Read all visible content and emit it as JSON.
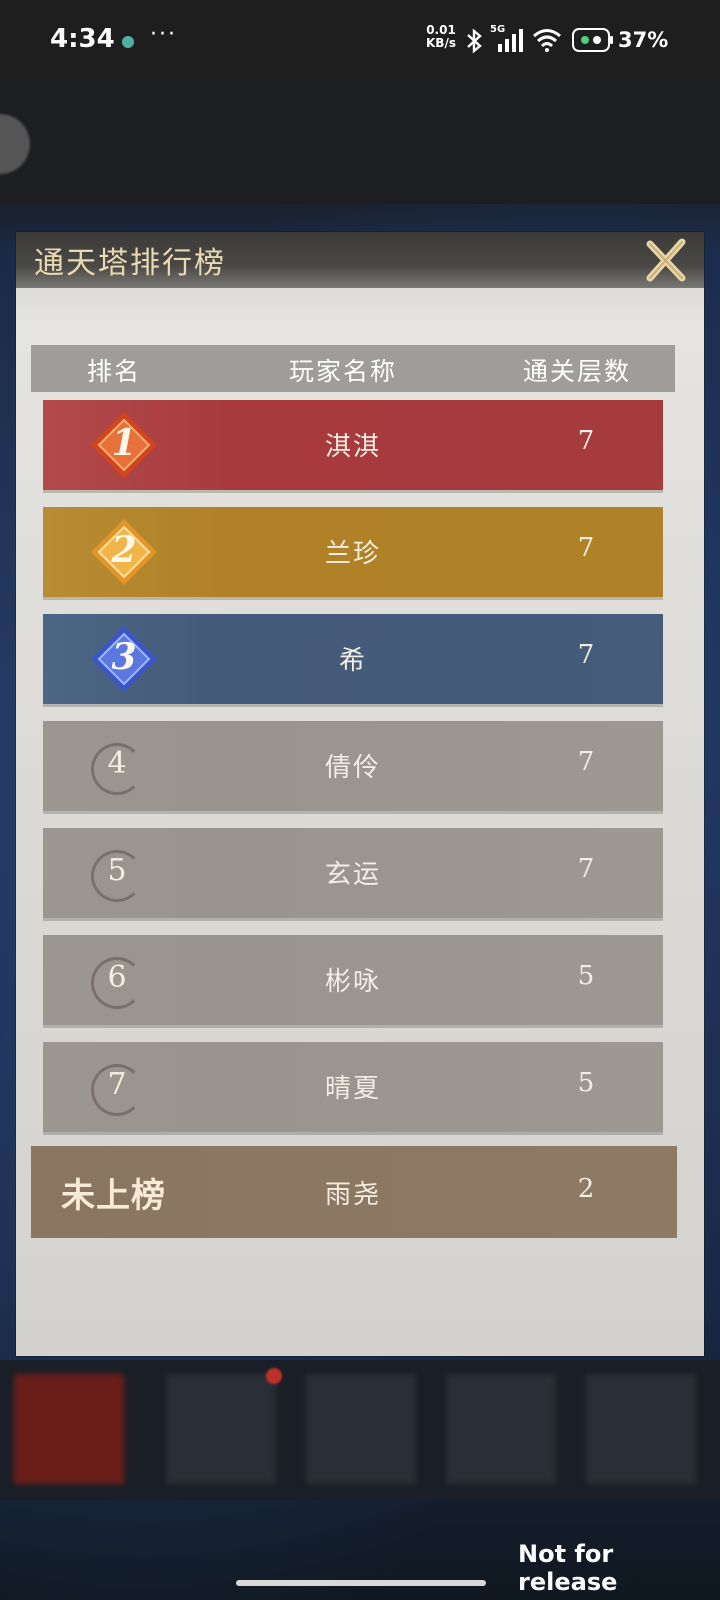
{
  "status_bar": {
    "time": "4:34",
    "more": "···",
    "net_speed_value": "0.01",
    "net_speed_unit": "KB/s",
    "network_type": "5G",
    "battery": "37%"
  },
  "dialog": {
    "title": "通天塔排行榜",
    "columns": {
      "rank": "排名",
      "player": "玩家名称",
      "floors": "通关层数"
    },
    "rows": [
      {
        "rank": "1",
        "name": "淇淇",
        "floors": "7",
        "tier_color": "#a83a3e"
      },
      {
        "rank": "2",
        "name": "兰珍",
        "floors": "7",
        "tier_color": "#b08126"
      },
      {
        "rank": "3",
        "name": "希",
        "floors": "7",
        "tier_color": "#435a78"
      },
      {
        "rank": "4",
        "name": "倩伶",
        "floors": "7"
      },
      {
        "rank": "5",
        "name": "玄运",
        "floors": "7"
      },
      {
        "rank": "6",
        "name": "彬咏",
        "floors": "5"
      },
      {
        "rank": "7",
        "name": "晴夏",
        "floors": "5"
      }
    ],
    "own_row": {
      "rank": "未上榜",
      "name": "雨尧",
      "floors": "2"
    },
    "close_icon": "close-x-icon"
  },
  "watermark": "Not for release"
}
